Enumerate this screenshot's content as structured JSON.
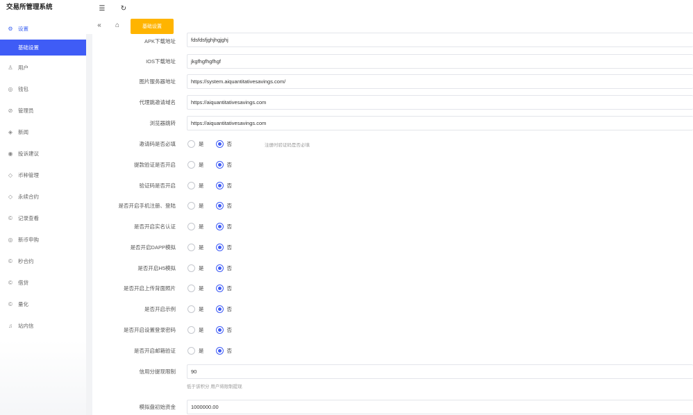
{
  "app": {
    "title": "交易所管理系统"
  },
  "sidebar": {
    "items": [
      {
        "label": "设置",
        "icon": "gear-icon",
        "glyph": "⚙",
        "active": true
      },
      {
        "label": "用户",
        "icon": "user-icon",
        "glyph": "♙"
      },
      {
        "label": "钱包",
        "icon": "wallet-icon",
        "glyph": "◎"
      },
      {
        "label": "管理员",
        "icon": "shield-icon",
        "glyph": "⊘"
      },
      {
        "label": "新闻",
        "icon": "tag-icon",
        "glyph": "◈"
      },
      {
        "label": "投诉建议",
        "icon": "eye-icon",
        "glyph": "◉"
      },
      {
        "label": "币种管理",
        "icon": "diamond-icon",
        "glyph": "◇"
      },
      {
        "label": "永续合约",
        "icon": "diamond-icon",
        "glyph": "◇"
      },
      {
        "label": "记录查看",
        "icon": "coin-icon",
        "glyph": "©"
      },
      {
        "label": "新币申购",
        "icon": "coin-icon",
        "glyph": "◎"
      },
      {
        "label": "秒合约",
        "icon": "coin-icon",
        "glyph": "©"
      },
      {
        "label": "借贷",
        "icon": "coin-icon",
        "glyph": "©"
      },
      {
        "label": "量化",
        "icon": "coin-icon",
        "glyph": "©"
      },
      {
        "label": "站内信",
        "icon": "bell-icon",
        "glyph": "♫"
      }
    ],
    "submenu": {
      "label": "基础设置"
    }
  },
  "topbar": {
    "menu_icon": "☰",
    "refresh_icon": "↻"
  },
  "tabs": {
    "back_icon": "«",
    "home_icon": "⌂",
    "active": "基础设置"
  },
  "form": {
    "apk": {
      "label": "APK下载地址",
      "value": "fdsfdsfjghjhgjghj"
    },
    "ios": {
      "label": "IOS下载地址",
      "value": "jkgfhgfhgfhgf"
    },
    "img_server": {
      "label": "图片服务器地址",
      "value": "https://system.aiquantitativesavings.com/"
    },
    "invite_domain": {
      "label": "代理跳邀请域名",
      "value": "https://aiquantitativesavings.com"
    },
    "browser_jump": {
      "label": "浏览器跳转",
      "value": "https://aiquantitativesavings.com"
    },
    "yes": "是",
    "no": "否",
    "invite_required": {
      "label": "邀请码是否必填",
      "hint": "注册时验证码是否必填"
    },
    "withdraw_verify": {
      "label": "提款验证是否开启"
    },
    "captcha": {
      "label": "验证码是否开启"
    },
    "phone_register": {
      "label": "是否开启手机注册、登陆"
    },
    "realname": {
      "label": "是否开启实名认证"
    },
    "dapp": {
      "label": "是否开启DAPP模拟"
    },
    "h5": {
      "label": "是否开启H5模拟"
    },
    "back_photo": {
      "label": "是否开启上传背面照片"
    },
    "demo": {
      "label": "是否开启示例"
    },
    "login_pwd": {
      "label": "是否开启设置登录密码"
    },
    "email_verify": {
      "label": "是否开启邮箱验证"
    },
    "credit_limit": {
      "label": "信用分提现限制",
      "value": "90",
      "hint": "低于该积分 用户将限制提现"
    },
    "sim_funds": {
      "label": "模拟盘初始资金",
      "value": "1000000.00"
    }
  }
}
